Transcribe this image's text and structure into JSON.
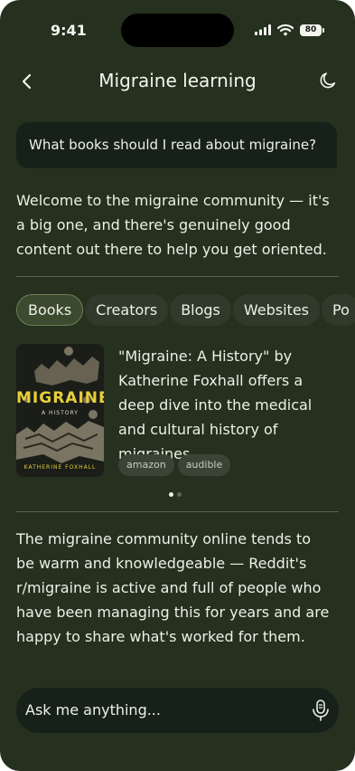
{
  "status_bar": {
    "time": "9:41",
    "battery": "80"
  },
  "header": {
    "title": "Migraine learning",
    "back_icon": "chevron-left-icon",
    "theme_icon": "moon-icon"
  },
  "user_message": "What books should I read about migraine?",
  "assistant": {
    "intro": "Welcome to the migraine community — it's a big one, and there's genuinely good content out there to help you get oriented.",
    "tabs": [
      "Books",
      "Creators",
      "Blogs",
      "Websites",
      "Po"
    ],
    "active_tab": "Books",
    "book": {
      "cover_title": "MIGRAINE",
      "cover_subtitle": "A HISTORY",
      "cover_author": "KATHERINE FOXHALL",
      "description": "\"Migraine: A History\" by Katherine Foxhall offers a deep dive into the medical and cultural history of migraines.",
      "links": [
        "amazon",
        "audible"
      ]
    },
    "carousel": {
      "count": 2,
      "active": 1
    },
    "community": "The migraine community online tends to be warm and knowledgeable — Reddit's r/migraine is active and full of people who have been managing this for years and are happy to share what's worked for them."
  },
  "composer": {
    "placeholder": "Ask me anything...",
    "mic_icon": "microphone-icon"
  },
  "colors": {
    "background": "#25301f",
    "bubble": "#16211a",
    "accent": "#e6cf3a"
  }
}
